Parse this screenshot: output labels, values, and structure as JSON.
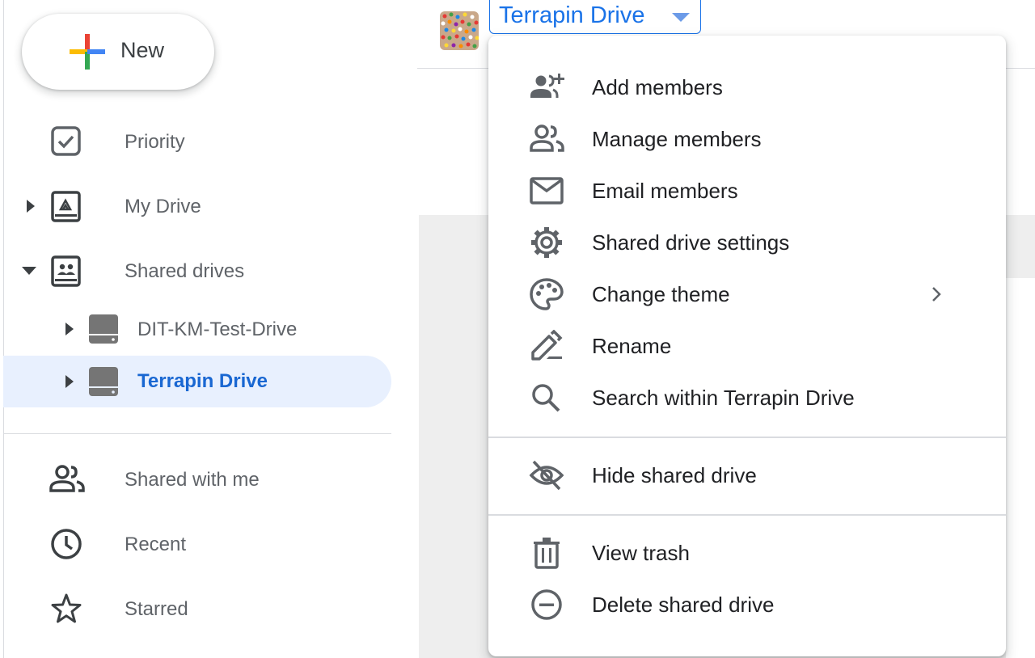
{
  "new_button": {
    "label": "New"
  },
  "sidebar": {
    "items": [
      {
        "id": "priority",
        "label": "Priority",
        "icon": "priority-checkbox-icon"
      },
      {
        "id": "my-drive",
        "label": "My Drive",
        "icon": "my-drive-icon"
      },
      {
        "id": "shared-drives",
        "label": "Shared drives",
        "icon": "shared-drives-icon"
      },
      {
        "id": "dit-km-test-drive",
        "label": "DIT-KM-Test-Drive",
        "icon": "drive-disk-icon"
      },
      {
        "id": "terrapin-drive",
        "label": "Terrapin Drive",
        "icon": "drive-disk-icon",
        "active": true
      },
      {
        "id": "shared-with-me",
        "label": "Shared with me",
        "icon": "people-icon"
      },
      {
        "id": "recent",
        "label": "Recent",
        "icon": "clock-icon"
      },
      {
        "id": "starred",
        "label": "Starred",
        "icon": "star-icon"
      }
    ]
  },
  "header": {
    "drive_title": "Terrapin Drive"
  },
  "menu": {
    "items": [
      {
        "label": "Add members",
        "icon": "add-person-icon"
      },
      {
        "label": "Manage members",
        "icon": "people-icon"
      },
      {
        "label": "Email members",
        "icon": "mail-icon"
      },
      {
        "label": "Shared drive settings",
        "icon": "gear-icon"
      },
      {
        "label": "Change theme",
        "icon": "palette-icon",
        "has_submenu": true
      },
      {
        "label": "Rename",
        "icon": "pencil-icon"
      },
      {
        "label": "Search within Terrapin Drive",
        "icon": "search-icon"
      },
      {
        "label": "Hide shared drive",
        "icon": "eye-off-icon"
      },
      {
        "label": "View trash",
        "icon": "trash-icon"
      },
      {
        "label": "Delete shared drive",
        "icon": "minus-circle-icon"
      }
    ]
  },
  "colors": {
    "accent": "#1a73e8",
    "active_bg": "#e8f0fe",
    "active_text": "#1967d2",
    "icon_gray": "#5f6368"
  }
}
